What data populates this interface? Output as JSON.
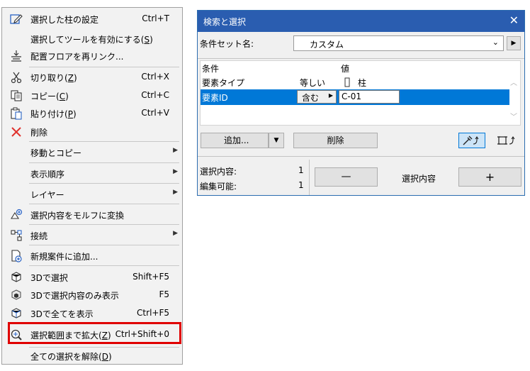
{
  "context_menu": {
    "items": [
      {
        "label": "選択した柱の設定",
        "shortcut": "Ctrl+T",
        "icon": "pencil-settings-icon"
      },
      {
        "label": "選択してツールを有効にする",
        "mnemonic": "S",
        "shortcut": "",
        "icon": ""
      },
      {
        "label": "配置フロアを再リンク...",
        "shortcut": "",
        "icon": "floor-relink-icon"
      },
      {
        "label": "切り取り",
        "mnemonic": "Z",
        "shortcut": "Ctrl+X",
        "icon": "scissors-icon"
      },
      {
        "label": "コピー",
        "mnemonic": "C",
        "shortcut": "Ctrl+C",
        "icon": "copy-icon"
      },
      {
        "label": "貼り付け",
        "mnemonic": "P",
        "shortcut": "Ctrl+V",
        "icon": "paste-icon"
      },
      {
        "label": "削除",
        "shortcut": "",
        "icon": "delete-x-icon"
      },
      {
        "label": "移動とコピー",
        "shortcut": "",
        "submenu": true
      },
      {
        "label": "表示順序",
        "shortcut": "",
        "submenu": true
      },
      {
        "label": "レイヤー",
        "shortcut": "",
        "submenu": true
      },
      {
        "label": "選択内容をモルフに変換",
        "shortcut": "",
        "icon": "morph-convert-icon"
      },
      {
        "label": "接続",
        "shortcut": "",
        "icon": "connect-icon",
        "submenu": true
      },
      {
        "label": "新規案件に追加...",
        "shortcut": "",
        "icon": "new-issue-icon"
      },
      {
        "label": "3Dで選択",
        "shortcut": "Shift+F5",
        "icon": "3d-select-icon"
      },
      {
        "label": "3Dで選択内容のみ表示",
        "shortcut": "F5",
        "icon": "3d-show-selection-icon"
      },
      {
        "label": "3Dで全てを表示",
        "shortcut": "Ctrl+F5",
        "icon": "3d-show-all-icon"
      },
      {
        "label": "選択範囲まで拡大",
        "mnemonic": "Z",
        "shortcut": "Ctrl+Shift+0",
        "icon": "zoom-selection-icon"
      },
      {
        "label": "全ての選択を解除",
        "mnemonic": "D",
        "shortcut": "",
        "icon": ""
      }
    ],
    "highlight_color": "#e00000"
  },
  "dialog": {
    "title": "検索と選択",
    "close_glyph": "✕",
    "criteria_set_label": "条件セット名:",
    "criteria_set_value": "カスタム",
    "table": {
      "col_criteria": "条件",
      "col_value": "値",
      "rows": [
        {
          "criteria": "要素タイプ",
          "operator": "等しい",
          "value": "柱"
        },
        {
          "criteria": "要素ID",
          "operator": "含む",
          "value": "C-01"
        }
      ]
    },
    "add_button": "追加...",
    "delete_button": "削除",
    "selection_label": "選択内容:",
    "selection_count": "1",
    "editable_label": "編集可能:",
    "editable_count": "1",
    "minus_button": "—",
    "selection_center_label": "選択内容",
    "plus_button": "+",
    "accent_color": "#0078d7",
    "title_color": "#2a5db0"
  }
}
